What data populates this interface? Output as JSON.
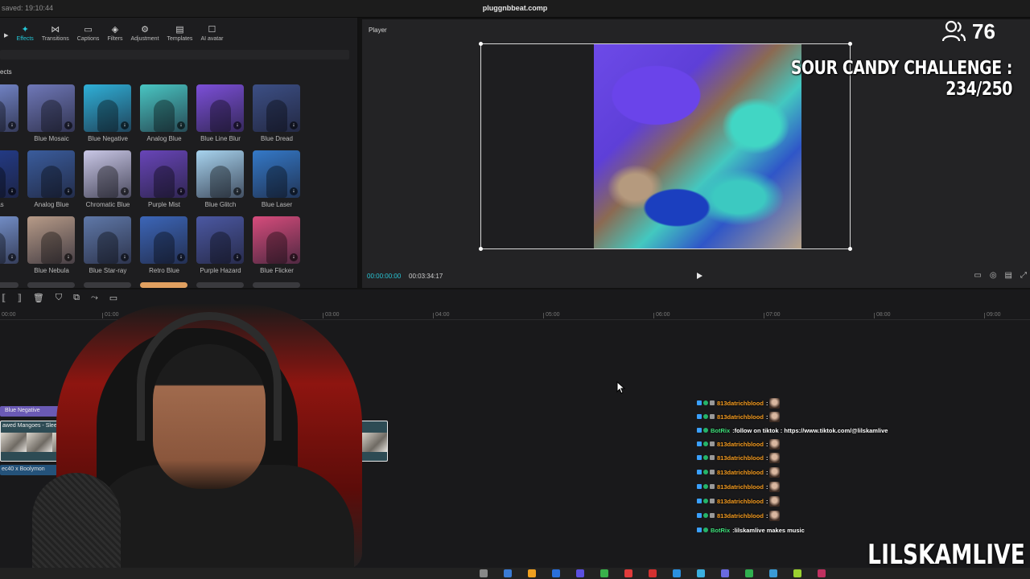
{
  "topbar": {
    "saved_text": "saved: 19:10:44",
    "project_title": "pluggnbbeat.comp"
  },
  "toolbar": [
    {
      "icon": "media-icon",
      "glyph": "▸",
      "label": ""
    },
    {
      "icon": "effects-icon",
      "glyph": "✦",
      "label": "Effects",
      "active": true
    },
    {
      "icon": "transitions-icon",
      "glyph": "⋈",
      "label": "Transitions"
    },
    {
      "icon": "captions-icon",
      "glyph": "▭",
      "label": "Captions"
    },
    {
      "icon": "filters-icon",
      "glyph": "◈",
      "label": "Filters"
    },
    {
      "icon": "adjustment-icon",
      "glyph": "⚙",
      "label": "Adjustment"
    },
    {
      "icon": "templates-icon",
      "glyph": "▤",
      "label": "Templates"
    },
    {
      "icon": "ai-avatar-icon",
      "glyph": "☐",
      "label": "AI avatar"
    }
  ],
  "effects_panel": {
    "section_label": "ects",
    "rows": [
      [
        {
          "label": "ue",
          "color": "#7b8fd6"
        },
        {
          "label": "Blue Mosaic",
          "color": "#6f78b8"
        },
        {
          "label": "Blue Negative",
          "color": "#2fb0d8"
        },
        {
          "label": "Analog Blue",
          "color": "#49c6c3"
        },
        {
          "label": "Blue Line Blur",
          "color": "#7c4fd8"
        },
        {
          "label": "Blue Dread",
          "color": "#3c4f85"
        }
      ],
      [
        {
          "label": "anvas",
          "color": "#243e8f"
        },
        {
          "label": "Analog Blue",
          "color": "#3a5c9c"
        },
        {
          "label": "Chromatic Blue",
          "color": "#c9c7e6"
        },
        {
          "label": "Purple Mist",
          "color": "#6845b8"
        },
        {
          "label": "Blue Glitch",
          "color": "#a7d3ee"
        },
        {
          "label": "Blue Laser",
          "color": "#3479c8"
        }
      ],
      [
        {
          "label": "lue",
          "color": "#7d9bd8"
        },
        {
          "label": "Blue Nebula",
          "color": "#b79b88"
        },
        {
          "label": "Blue Star-ray",
          "color": "#5f78a8"
        },
        {
          "label": "Retro Blue",
          "color": "#3c66b8"
        },
        {
          "label": "Purple Hazard",
          "color": "#4b58a2"
        },
        {
          "label": "Blue Flicker",
          "color": "#d64c7c"
        }
      ]
    ]
  },
  "player": {
    "label": "Player",
    "time_current": "00:00:00:00",
    "time_total": "00:03:34:17"
  },
  "overlay": {
    "viewer_count": "76",
    "challenge_text": "SOUR CANDY CHALLENGE : 234/250",
    "streamer_name": "LILSKAMLIVE"
  },
  "timeline": {
    "ruler_ticks": [
      "00:00",
      "01:00",
      "03:00",
      "04:00",
      "05:00",
      "06:00",
      "07:00",
      "08:00",
      "09:00"
    ],
    "fx_track_label": "Blue Negative",
    "video_clip_label": "awed Mangoes - Sleep",
    "audio_clip_label": "ec40 x Boolymon"
  },
  "chat": [
    {
      "user": "813datrichblood",
      "user_color": "#f39a1e",
      "msg": "",
      "emote": true
    },
    {
      "user": "813datrichblood",
      "user_color": "#f39a1e",
      "msg": "",
      "emote": true
    },
    {
      "user": "BotRix",
      "user_color": "#3ee07a",
      "msg": "follow on tiktok : https://www.tiktok.com/@lilskamlive",
      "emote": false
    },
    {
      "user": "813datrichblood",
      "user_color": "#f39a1e",
      "msg": "",
      "emote": true
    },
    {
      "user": "813datrichblood",
      "user_color": "#f39a1e",
      "msg": "",
      "emote": true
    },
    {
      "user": "813datrichblood",
      "user_color": "#f39a1e",
      "msg": "",
      "emote": true
    },
    {
      "user": "813datrichblood",
      "user_color": "#f39a1e",
      "msg": "",
      "emote": true
    },
    {
      "user": "813datrichblood",
      "user_color": "#f39a1e",
      "msg": "",
      "emote": true
    },
    {
      "user": "813datrichblood",
      "user_color": "#f39a1e",
      "msg": "",
      "emote": true
    },
    {
      "user": "BotRix",
      "user_color": "#3ee07a",
      "msg": "lilskamlive makes music",
      "emote": false
    }
  ],
  "colors": {
    "accent": "#24c8d8",
    "background": "#121212",
    "panel": "#1d1d1f"
  }
}
